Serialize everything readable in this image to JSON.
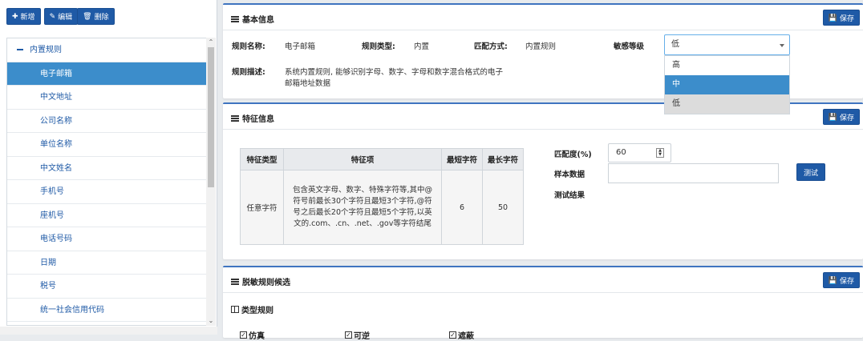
{
  "toolbar": {
    "add_label": "新增",
    "edit_label": "编辑",
    "delete_label": "删除"
  },
  "tree": {
    "root_label": "内置规则",
    "items": [
      "电子邮箱",
      "中文地址",
      "公司名称",
      "单位名称",
      "中文姓名",
      "手机号",
      "座机号",
      "电话号码",
      "日期",
      "税号",
      "统一社会信用代码"
    ]
  },
  "basic": {
    "title": "基本信息",
    "save_label": "保存",
    "rule_name_label": "规则名称:",
    "rule_name_value": "电子邮箱",
    "rule_type_label": "规则类型:",
    "rule_type_value": "内置",
    "match_mode_label": "匹配方式:",
    "match_mode_value": "内置规则",
    "sensitivity_label": "敏感等级",
    "sensitivity_value": "低",
    "sensitivity_options": [
      "高",
      "中",
      "低"
    ],
    "desc_label": "规则描述:",
    "desc_line1": "系统内置规则, 能够识别字母、数字、字母和数字混合格式的电子",
    "desc_line2": "邮箱地址数据"
  },
  "feature": {
    "title": "特征信息",
    "save_label": "保存",
    "table_headers": [
      "特征类型",
      "特征项",
      "最短字符",
      "最长字符"
    ],
    "row": {
      "type": "任意字符",
      "item": "包含英文字母、数字、特殊字符等,其中@符号前最长30个字符且最短3个字符,@符号之后最长20个字符且最短5个字符,以英文的.com、.cn、.net、.gov等字符结尾",
      "min": "6",
      "max": "50"
    },
    "match_degree_label": "匹配度(%)",
    "match_degree_value": "60",
    "sample_label": "样本数据",
    "test_label": "测试",
    "result_label": "测试结果"
  },
  "candidate": {
    "title": "脱敏规则候选",
    "save_label": "保存",
    "sub_title": "类型规则",
    "checks": [
      "仿真",
      "可逆",
      "遮蔽"
    ]
  },
  "colors": {
    "primary": "#1f5aa6",
    "selected": "#3c8dcb",
    "panel_border": "#3f74c0"
  }
}
